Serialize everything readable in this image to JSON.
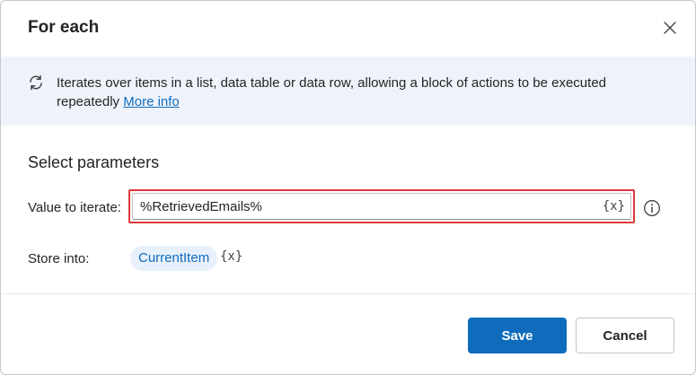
{
  "dialog": {
    "title": "For each"
  },
  "info": {
    "description": "Iterates over items in a list, data table or data row, allowing a block of actions to be executed repeatedly",
    "link_text": "More info",
    "icon": "loop-icon"
  },
  "parameters": {
    "section_title": "Select parameters",
    "value_to_iterate": {
      "label": "Value to iterate:",
      "value": "%RetrievedEmails%",
      "variable_button": "{x}"
    },
    "store_into": {
      "label": "Store into:",
      "value": "CurrentItem",
      "variable_button": "{x}"
    }
  },
  "buttons": {
    "save": "Save",
    "cancel": "Cancel"
  },
  "colors": {
    "accent": "#0f6cbd",
    "highlight_border": "#e0383e",
    "banner_bg": "#eef3fb"
  }
}
